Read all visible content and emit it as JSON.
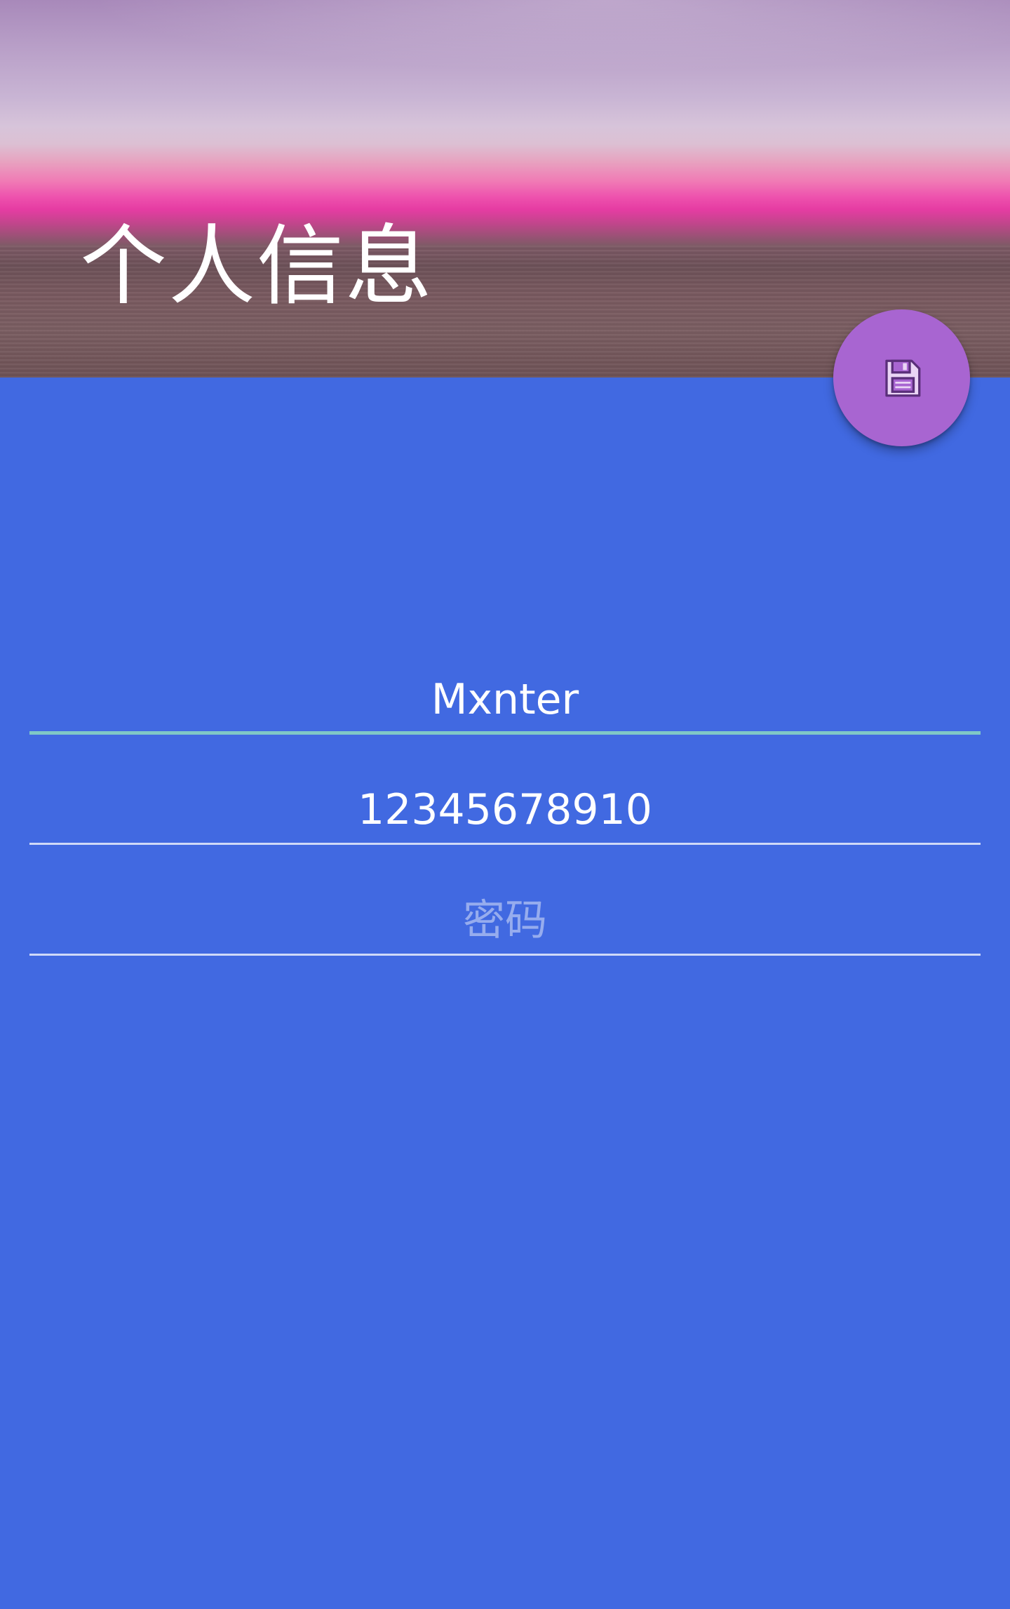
{
  "header": {
    "title": "个人信息"
  },
  "fab": {
    "icon": "save-icon",
    "color": "#A865D1"
  },
  "form": {
    "username": {
      "value": "Mxnter",
      "placeholder": ""
    },
    "phone": {
      "value": "12345678910",
      "placeholder": ""
    },
    "password": {
      "value": "",
      "placeholder": "密码"
    }
  },
  "colors": {
    "background": "#4169E1",
    "focused_underline": "#7FC8C6",
    "underline": "#C8D2F5"
  }
}
